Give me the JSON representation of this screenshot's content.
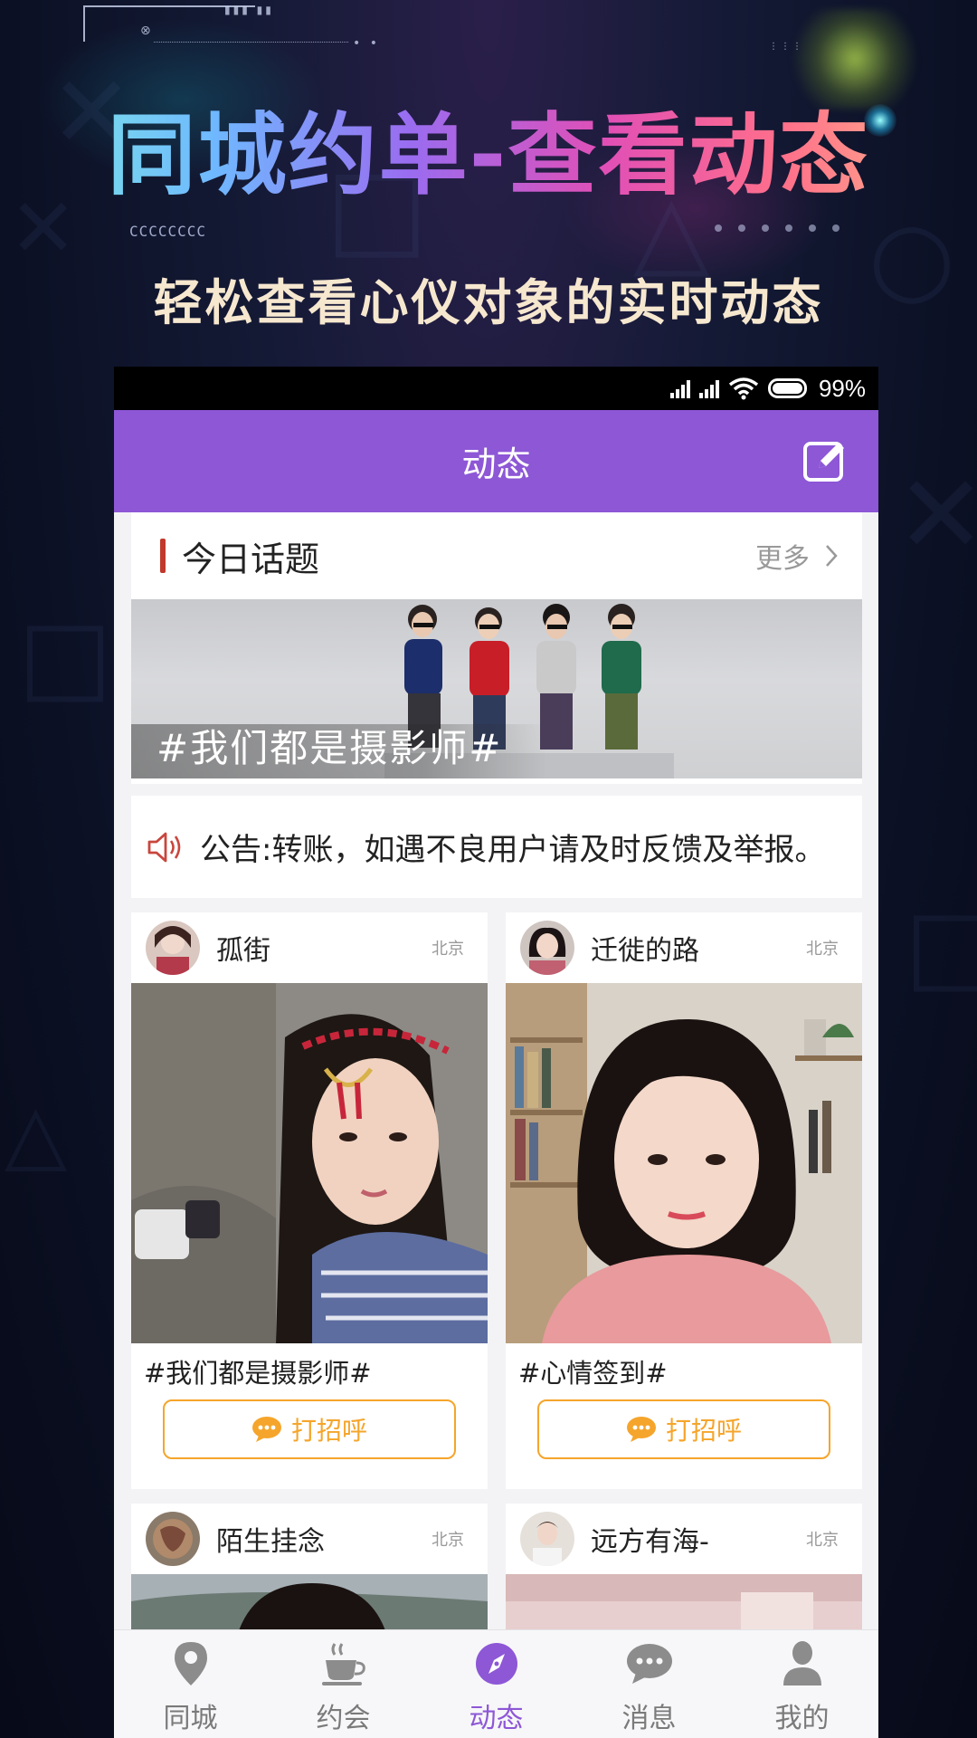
{
  "promo": {
    "title": "同城约单-查看动态",
    "code_text": "CCCCCCCC",
    "subtitle": "轻松查看心仪对象的实时动态"
  },
  "status_bar": {
    "battery": "99%"
  },
  "header": {
    "title": "动态",
    "edit_icon": "edit-icon"
  },
  "topic": {
    "title": "今日话题",
    "more": "更多",
    "banner_caption": "#我们都是摄影师#"
  },
  "notice": {
    "text": "公告:转账，如遇不良用户请及时反馈及举报。"
  },
  "posts": [
    {
      "name": "孤街",
      "city": "北京",
      "tag": "#我们都是摄影师#",
      "greet": "打招呼"
    },
    {
      "name": "迁徙的路",
      "city": "北京",
      "tag": "#心情签到#",
      "greet": "打招呼"
    },
    {
      "name": "陌生挂念",
      "city": "北京"
    },
    {
      "name": "远方有海-",
      "city": "北京"
    }
  ],
  "nav": [
    {
      "label": "同城",
      "icon": "location-pin-icon"
    },
    {
      "label": "约会",
      "icon": "coffee-cup-icon"
    },
    {
      "label": "动态",
      "icon": "compass-icon",
      "active": true
    },
    {
      "label": "消息",
      "icon": "chat-bubble-icon"
    },
    {
      "label": "我的",
      "icon": "person-icon"
    }
  ],
  "colors": {
    "accent": "#8d57d6",
    "greet": "#f5a52b",
    "topic_bar": "#c0392b"
  }
}
